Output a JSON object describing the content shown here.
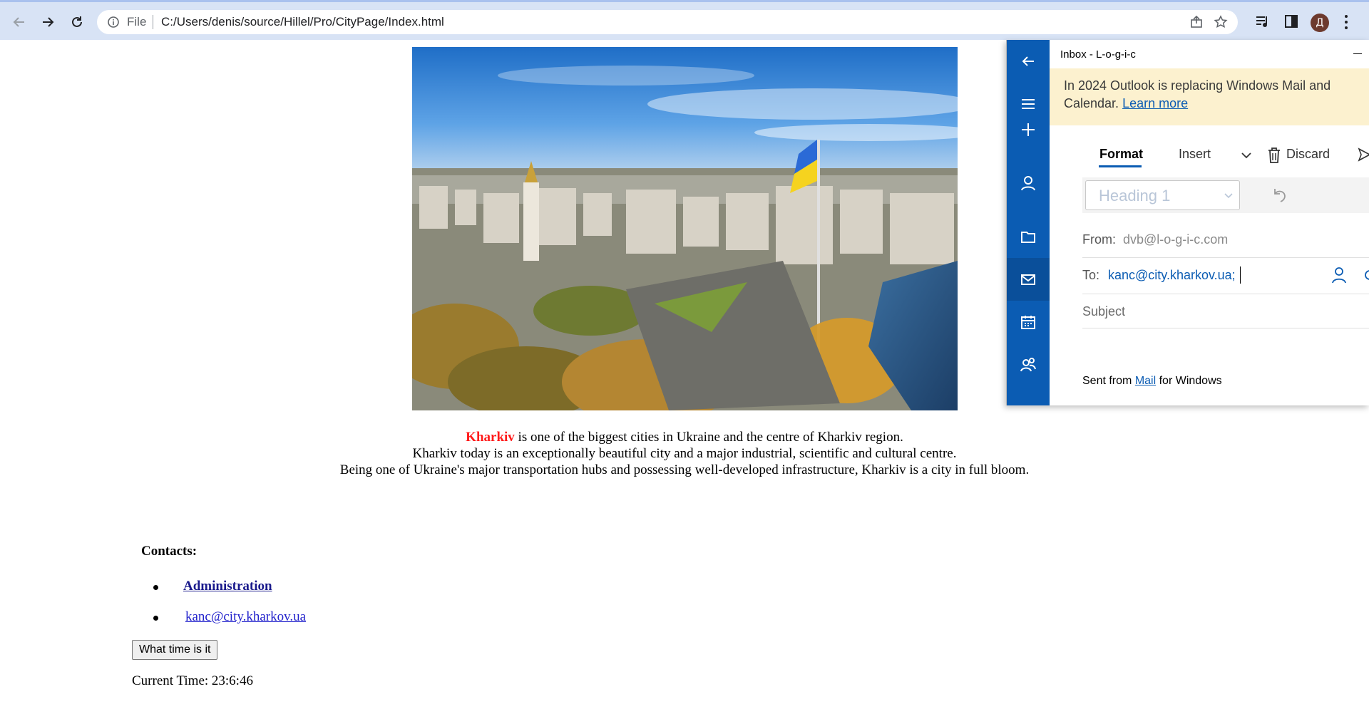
{
  "browser": {
    "file_label": "File",
    "url": "C:/Users/denis/source/Hillel/Pro/CityPage/Index.html",
    "profile_initial": "Д"
  },
  "page": {
    "intro": {
      "city": "Kharkiv",
      "line1_rest": " is one of the biggest cities in Ukraine and the centre of Kharkiv region.",
      "line2": "Kharkiv today is an exceptionally beautiful city and a major industrial, scientific and cultural centre.",
      "line3": "Being one of Ukraine's major transportation hubs and possessing well-developed infrastructure, Kharkiv is a city in full bloom."
    },
    "contacts": {
      "title": "Contacts:",
      "admin_link": "Administration",
      "email_link": "kanc@city.kharkov.ua"
    },
    "time_button": "What time is it",
    "current_time": "Current Time: 23:6:46"
  },
  "mail": {
    "window_title": "Inbox - L-o-g-i-c",
    "banner_text": "In 2024 Outlook is replacing Windows Mail and Calendar. ",
    "banner_link": "Learn more",
    "tabs": {
      "format": "Format",
      "insert": "Insert",
      "discard": "Discard"
    },
    "style_select": "Heading 1",
    "from_label": "From:",
    "from_value": "dvb@l-o-g-i-c.com",
    "to_label": "To:",
    "to_value": "kanc@city.kharkov.ua;",
    "subject_placeholder": "Subject",
    "signature_pre": "Sent from ",
    "signature_link": "Mail",
    "signature_post": " for Windows",
    "accent": "#0b5cb3"
  }
}
